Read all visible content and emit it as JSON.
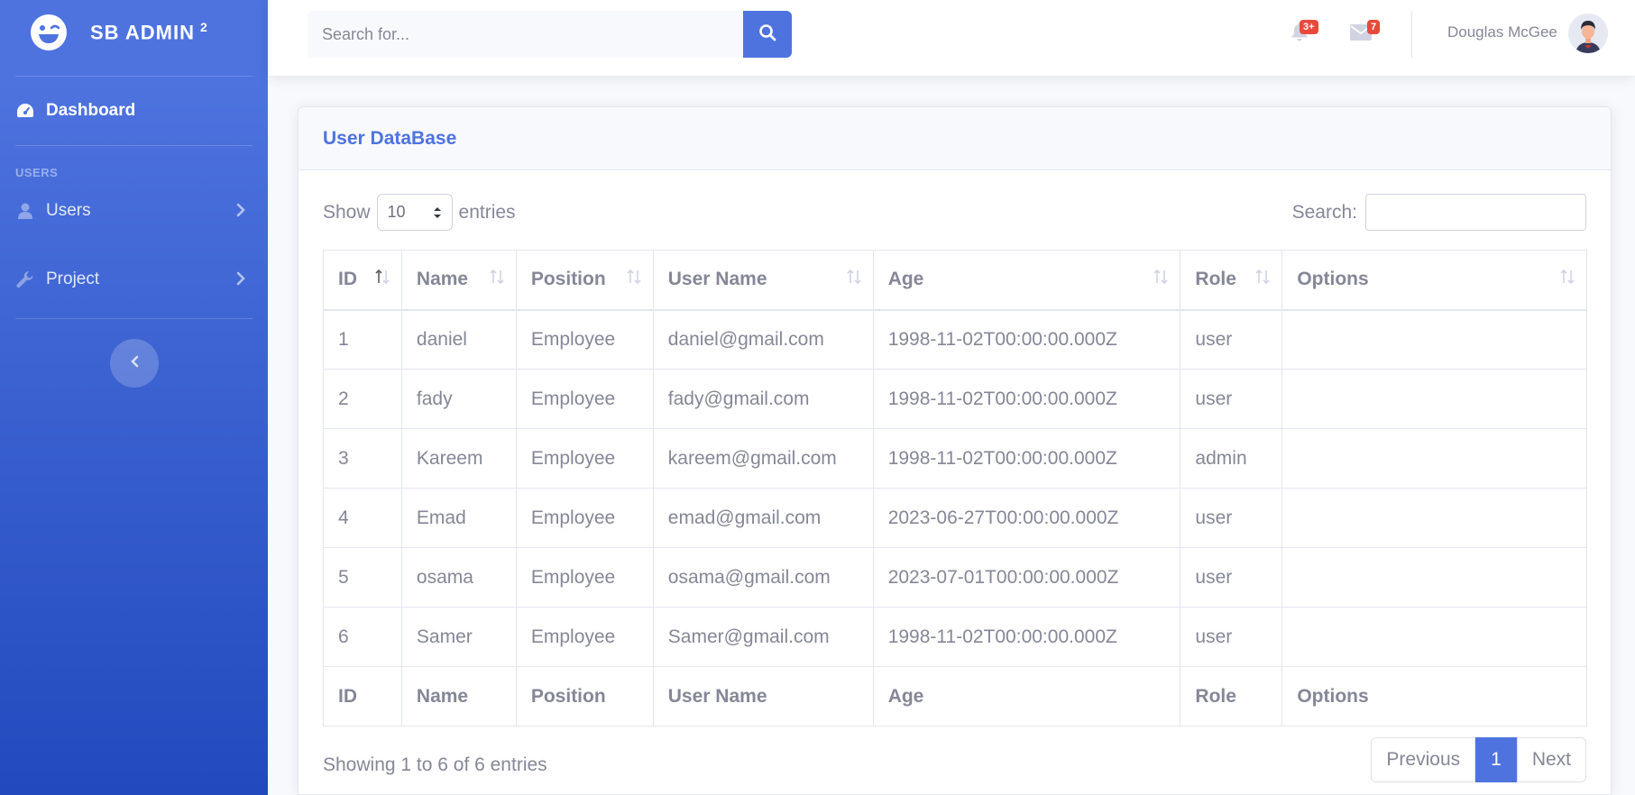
{
  "sidebar": {
    "brand": {
      "name": "SB ADMIN",
      "sup": "2"
    },
    "dashboard_label": "Dashboard",
    "heading": "USERS",
    "items": [
      {
        "label": "Users",
        "icon": "user-icon"
      },
      {
        "label": "Project",
        "icon": "wrench-icon"
      }
    ]
  },
  "topbar": {
    "search_placeholder": "Search for...",
    "alerts_badge": "3+",
    "messages_badge": "7",
    "user_name": "Douglas McGee"
  },
  "card": {
    "title": "User DataBase",
    "show_label": "Show",
    "entries_label": "entries",
    "page_length": "10",
    "search_label": "Search:",
    "columns": [
      "ID",
      "Name",
      "Position",
      "User Name",
      "Age",
      "Role",
      "Options"
    ],
    "rows": [
      [
        "1",
        "daniel",
        "Employee",
        "daniel@gmail.com",
        "1998-11-02T00:00:00.000Z",
        "user",
        ""
      ],
      [
        "2",
        "fady",
        "Employee",
        "fady@gmail.com",
        "1998-11-02T00:00:00.000Z",
        "user",
        ""
      ],
      [
        "3",
        "Kareem",
        "Employee",
        "kareem@gmail.com",
        "1998-11-02T00:00:00.000Z",
        "admin",
        ""
      ],
      [
        "4",
        "Emad",
        "Employee",
        "emad@gmail.com",
        "2023-06-27T00:00:00.000Z",
        "user",
        ""
      ],
      [
        "5",
        "osama",
        "Employee",
        "osama@gmail.com",
        "2023-07-01T00:00:00.000Z",
        "user",
        ""
      ],
      [
        "6",
        "Samer",
        "Employee",
        "Samer@gmail.com",
        "1998-11-02T00:00:00.000Z",
        "user",
        ""
      ]
    ],
    "info": "Showing 1 to 6 of 6 entries",
    "pagination": {
      "previous": "Previous",
      "current": "1",
      "next": "Next"
    }
  },
  "colors": {
    "primary": "#4e73df",
    "danger": "#e74a3b",
    "text": "#858796"
  }
}
